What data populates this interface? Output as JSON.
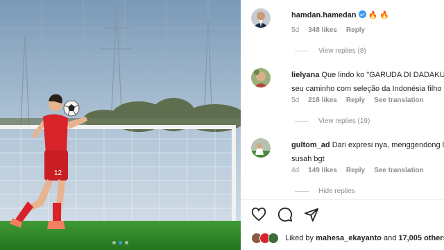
{
  "post": {
    "carousel_index": 2,
    "carousel_count": 3,
    "jersey_number": "12"
  },
  "comments": [
    {
      "username": "hamdan.hamedan",
      "verified": true,
      "text": "🔥 🔥",
      "time": "5d",
      "likes": "348 likes",
      "reply": "Reply",
      "view_replies": "View replies (8)"
    },
    {
      "username": "lielyana",
      "text": "Que lindo ko \"GARUDA DI DADAKU\"",
      "text_line2": "seu caminho com seleção da Indonésia filho",
      "time": "5d",
      "likes": "218 likes",
      "reply": "Reply",
      "translation": "See translation",
      "view_replies": "View replies (19)"
    },
    {
      "username": "gultom_ad",
      "text": "Dari expresi nya, menggendong l",
      "text_line2": "susah bgt",
      "time": "4d",
      "likes": "149 likes",
      "reply": "Reply",
      "translation": "See translation",
      "hide_replies": "Hide replies"
    }
  ],
  "actions": {
    "like": "heart-icon",
    "comment": "comment-icon",
    "share": "share-icon"
  },
  "liked_by": {
    "prefix": "Liked by",
    "user": "mahesa_ekayanto",
    "connector": "and",
    "others": "17,005 others"
  },
  "colors": {
    "verified": "#3897f0",
    "meta": "#8e8e8e",
    "jersey": "#d8232a",
    "grass": "#2f8a2a"
  }
}
